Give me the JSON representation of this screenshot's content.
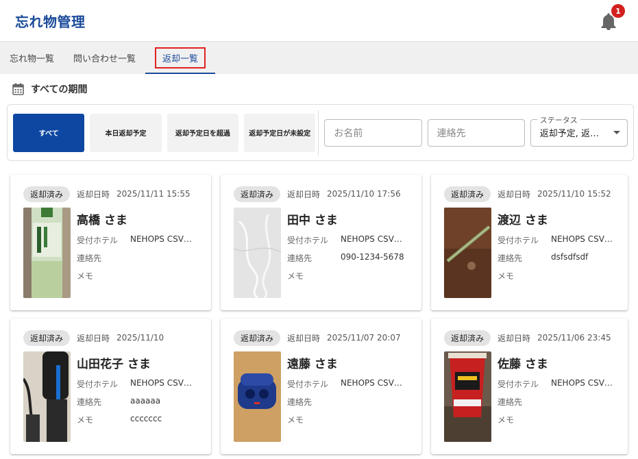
{
  "app": {
    "title": "忘れ物管理",
    "notification_count": "1"
  },
  "tabs": [
    {
      "label": "忘れ物一覧"
    },
    {
      "label": "問い合わせ一覧"
    },
    {
      "label": "返却一覧"
    }
  ],
  "period": {
    "title": "すべての期間"
  },
  "filters": {
    "buttons": [
      "すべて",
      "本日返却予定",
      "返却予定日を超過",
      "返却予定日が未設定"
    ],
    "name_placeholder": "お名前",
    "contact_placeholder": "連絡先",
    "status_label": "ステータス",
    "status_value": "返却予定, 返…"
  },
  "labels": {
    "date": "返却日時",
    "hotel": "受付ホテル",
    "contact": "連絡先",
    "memo": "メモ"
  },
  "cards": [
    {
      "status": "返却済み",
      "date": "2025/11/11 15:55",
      "name": "高橋 さま",
      "hotel": "NEHOPS CSV…",
      "contact": "",
      "memo": ""
    },
    {
      "status": "返却済み",
      "date": "2025/11/10 17:56",
      "name": "田中 さま",
      "hotel": "NEHOPS CSV…",
      "contact": "090-1234-5678",
      "memo": ""
    },
    {
      "status": "返却済み",
      "date": "2025/11/10 15:52",
      "name": "渡辺 さま",
      "hotel": "NEHOPS CSV…",
      "contact": "dsfsdfsdf",
      "memo": ""
    },
    {
      "status": "返却済み",
      "date": "2025/11/10",
      "name": "山田花子 さま",
      "hotel": "NEHOPS CSV…",
      "contact": "aaaaaa",
      "memo": "ccccccc"
    },
    {
      "status": "返却済み",
      "date": "2025/11/07 20:07",
      "name": "遠藤 さま",
      "hotel": "NEHOPS CSV…",
      "contact": "",
      "memo": ""
    },
    {
      "status": "返却済み",
      "date": "2025/11/06 23:45",
      "name": "佐藤 さま",
      "hotel": "NEHOPS CSV…",
      "contact": "",
      "memo": ""
    }
  ]
}
